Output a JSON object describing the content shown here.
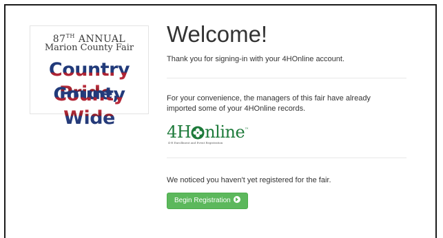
{
  "fair_logo": {
    "line1_number": "87",
    "line1_suffix": "TH",
    "line1_rest": "ANNUAL",
    "line2": "Marion County Fair",
    "line3": "Country Pride,",
    "line4": "County Wide"
  },
  "welcome": {
    "title": "Welcome!",
    "signin_text": "Thank you for signing-in with your 4HOnline account.",
    "import_text": "For your convenience, the managers of this fair have already imported some of your 4HOnline records.",
    "registration_text": "We noticed you haven't yet registered for the fair.",
    "button_label": "Begin Registration"
  },
  "logo_4h": {
    "brand_prefix": "4H",
    "brand_suffix": "nline",
    "tagline": "4-H Enrollment and Event Registration",
    "color": "#1d7a3a"
  },
  "colors": {
    "button": "#5cb85c",
    "text": "#333333"
  }
}
